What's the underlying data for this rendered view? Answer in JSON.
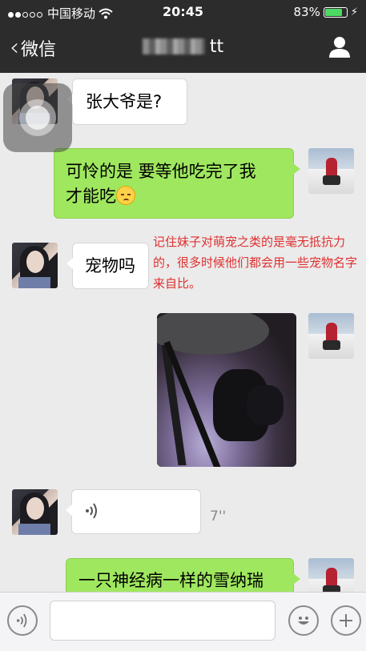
{
  "status": {
    "carrier": "中国移动",
    "time": "20:45",
    "battery": "83%",
    "battery_level": 0.83
  },
  "nav": {
    "back_label": "微信",
    "title_suffix": "tt"
  },
  "messages": [
    {
      "from": "contact",
      "text": "张大爷是?"
    },
    {
      "from": "me",
      "text_line1": "可怜的是 要等他吃完了我",
      "text_line2": "才能吃"
    },
    {
      "from": "contact",
      "text": "宠物吗"
    },
    {
      "from": "me",
      "type": "photo"
    },
    {
      "from": "contact",
      "type": "voice",
      "duration": "7''"
    },
    {
      "from": "me",
      "text": "一只神经病一样的雪纳瑞"
    }
  ],
  "annotation": "记住妹子对萌宠之类的是毫无抵抗力的，很多时候他们都会用一些宠物名字来自比。",
  "icons": {
    "back": "chevron-left-icon",
    "profile": "person-icon",
    "voice": "voice-wave-icon",
    "emoji": "smiley-icon",
    "add": "plus-icon",
    "wifi": "wifi-icon",
    "battery": "battery-icon"
  },
  "colors": {
    "nav_bg": "#2c2c2c",
    "bubble_green": "#9fe75f",
    "annotation_red": "#e03030"
  },
  "input": {
    "value": ""
  }
}
